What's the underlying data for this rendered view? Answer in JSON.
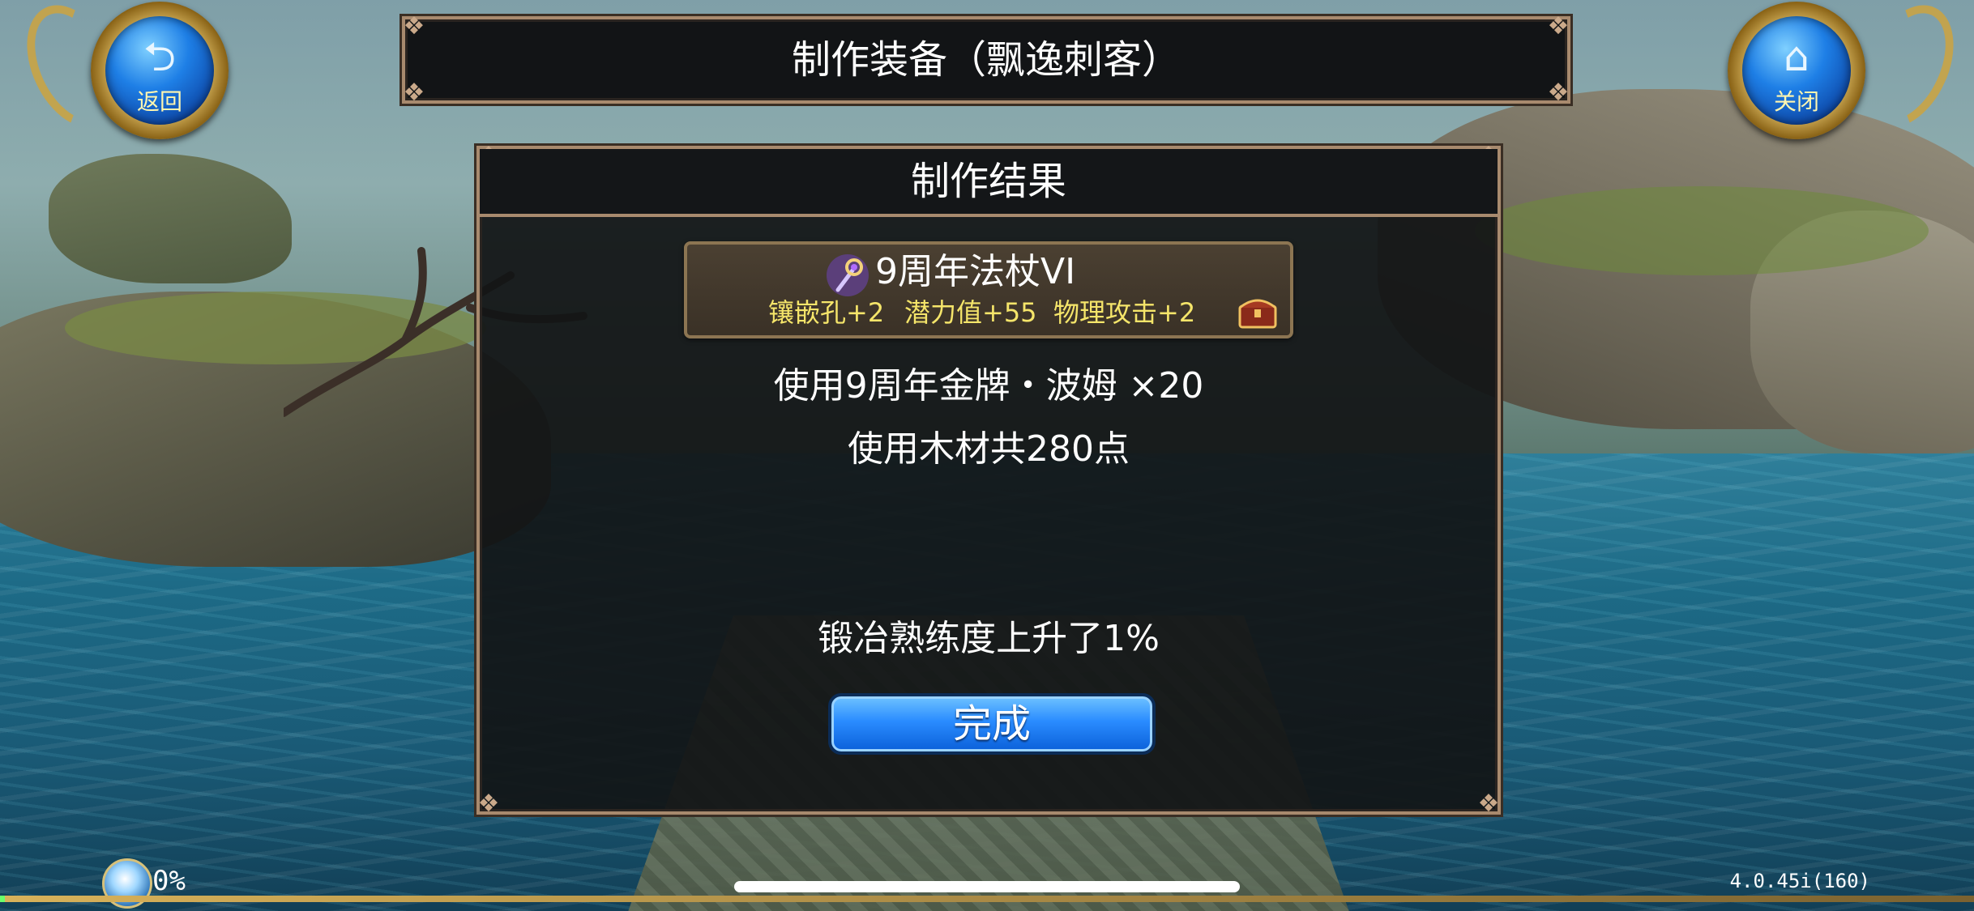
{
  "header": {
    "title": "制作装备（飘逸刺客）",
    "back_button": {
      "icon": "back-arrow-icon",
      "label": "返回"
    },
    "close_button": {
      "icon": "home-icon",
      "label": "关闭"
    }
  },
  "dialog": {
    "title": "制作结果",
    "item": {
      "icon": "staff-icon",
      "name": "9周年法杖VI",
      "stats": [
        "镶嵌孔+2",
        "潜力值+55",
        "物理攻击+2"
      ],
      "badge_icon": "treasure-chest-icon"
    },
    "material_line": "使用9周年金牌・波姆 ×20",
    "wood_line": "使用木材共280点",
    "proficiency_line": "锻冶熟练度上升了1%",
    "confirm_label": "完成"
  },
  "hud": {
    "progress_text": "0%",
    "progress_value": 0.0,
    "version": "4.0.45i(160)"
  },
  "colors": {
    "accent_blue": "#2a8cff",
    "frame_border": "#a88a6e",
    "stat_yellow": "#f5e56a",
    "panel_bg": "#121416"
  }
}
